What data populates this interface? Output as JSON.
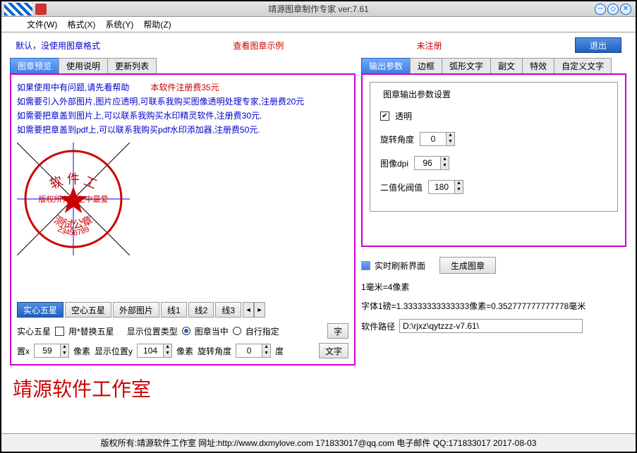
{
  "title": "靖源图章制作专家 ver:7.61",
  "menu": {
    "file": "文件(W)",
    "format": "格式(X)",
    "system": "系统(Y)",
    "help": "帮助(Z)"
  },
  "top": {
    "default_text": "默认，没使用图章格式",
    "view_sample": "查看图章示例",
    "unregistered": "未注册",
    "exit": "退出"
  },
  "left_tabs": [
    "图章预览",
    "使用说明",
    "更新列表"
  ],
  "help": {
    "l1a": "如果使用中有问题,请先看帮助",
    "l1b": "本软件注册费35元",
    "l2": "如需要引入外部图片,图片应透明,可联系我购买图像透明处理专家,注册费20元",
    "l3": "如需要把章盖到图片上,可以联系我购买水印精灵软件,注册费30元.",
    "l4": "如需要把章盖到pdf上,可以联系我购买pdf水印添加器,注册费50元."
  },
  "stamp": {
    "top_text": "软 件 工",
    "mid_text": "版权所有★生中最爱",
    "test_text": "测试公章",
    "numbers": "23456789"
  },
  "shape_tabs": [
    "实心五星",
    "空心五星",
    "外部图片",
    "线1",
    "线2",
    "线3"
  ],
  "controls": {
    "label_solid": "实心五星",
    "replace_star": "用*替换五星",
    "pos_type": "显示位置类型",
    "center": "图章当中",
    "custom": "自行指定",
    "font_btn": "字",
    "text_btn": "文字",
    "x_label": "置x",
    "x_val": "59",
    "px1": "像素",
    "y_label": "显示位置y",
    "y_val": "104",
    "px2": "像素",
    "rot_label": "旋转角度",
    "rot_val": "0",
    "deg": "度"
  },
  "right_tabs": [
    "输出参数",
    "边框",
    "弧形文字",
    "副文",
    "特效",
    "自定义文字"
  ],
  "output": {
    "group_title": "图章输出参数设置",
    "transparent": "透明",
    "rotation": "旋转角度",
    "rotation_val": "0",
    "dpi_label": "图像dpi",
    "dpi_val": "96",
    "threshold": "二值化阀值",
    "threshold_val": "180"
  },
  "right_lower": {
    "refresh": "实时刷新界面",
    "generate": "生成图章",
    "mm_px": "1毫米=4像素",
    "font_info": "字体1磅=1.33333333333333像素=0.352777777777778毫米",
    "path_label": "软件路径",
    "path_val": "D:\\rjxz\\qytzzz-v7.61\\"
  },
  "studio": "靖源软件工作室",
  "footer": "版权所有:靖源软件工作室 网址:http://www.dxmylove.com 171833017@qq.com 电子邮件 QQ:171833017  2017-08-03"
}
